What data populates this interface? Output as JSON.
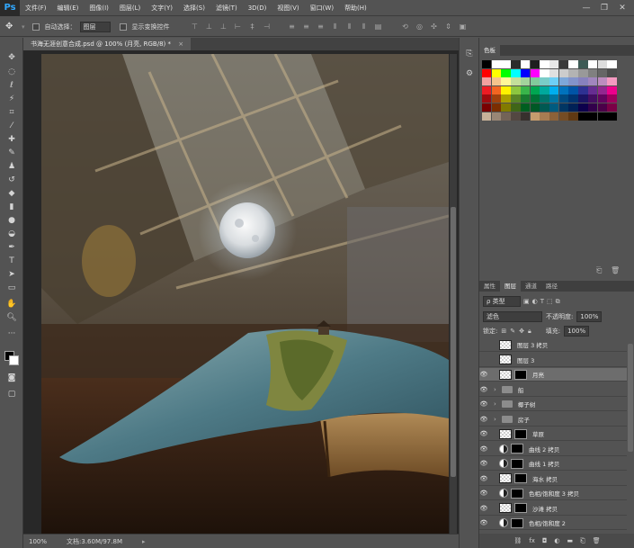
{
  "app": {
    "logo": "Ps"
  },
  "menu": [
    "文件(F)",
    "编辑(E)",
    "图像(I)",
    "图层(L)",
    "文字(Y)",
    "选择(S)",
    "滤镜(T)",
    "3D(D)",
    "视图(V)",
    "窗口(W)",
    "帮助(H)"
  ],
  "window_controls": {
    "minimize": "—",
    "restore": "❐",
    "close": "✕"
  },
  "options": {
    "move_icon": "move-icon",
    "auto_select_label": "自动选择：",
    "auto_select_value": "图层",
    "show_transform_label": "显示变换控件"
  },
  "document": {
    "tab_title": "书海无涯创意合成.psd @ 100% (月亮, RGB/8) *",
    "close": "×"
  },
  "status": {
    "zoom": "100%",
    "doc_size": "文档:3.60M/97.8M"
  },
  "panels": {
    "swatches_tab": "色板",
    "layer_tabs": [
      "属性",
      "图层",
      "通道",
      "路径"
    ],
    "filter_kind": "ρ 类型",
    "blend_mode": "滤色",
    "opacity_label": "不透明度:",
    "opacity_value": "100%",
    "lock_label": "锁定:",
    "fill_label": "填充:",
    "fill_value": "100%"
  },
  "swatch_colors": [
    [
      "#000000",
      "#ffffff",
      "#ffffff",
      "#2b2b2b",
      "#ffffff",
      "#1e1e1e",
      "#ffffff",
      "#e8e8e8",
      "#3a3a3a",
      "#ffffff",
      "#3d5b55",
      "#ffffff",
      "#dddddd",
      "#ffffff"
    ],
    [
      "#ff0000",
      "#ffff00",
      "#00ff00",
      "#00ffff",
      "#0000ff",
      "#ff00ff",
      "#ffffff",
      "#e0e0e0",
      "#cccccc",
      "#b3b3b3",
      "#999999",
      "#808080",
      "#666666",
      "#4d4d4d"
    ],
    [
      "#f2a0a0",
      "#f5c48c",
      "#fff799",
      "#c4df9b",
      "#a3d39c",
      "#82ca9c",
      "#7accc8",
      "#6dcff6",
      "#7da7d9",
      "#8393ca",
      "#8781bd",
      "#a186be",
      "#bd8cbf",
      "#f49ac1"
    ],
    [
      "#ed1c24",
      "#f26522",
      "#fff200",
      "#8dc63f",
      "#39b54a",
      "#00a651",
      "#00a99d",
      "#00aeef",
      "#0072bc",
      "#0054a6",
      "#2e3192",
      "#662d91",
      "#92278f",
      "#ec008c"
    ],
    [
      "#9e0b0f",
      "#a0410d",
      "#aba000",
      "#598527",
      "#197b30",
      "#007236",
      "#00746b",
      "#0076a3",
      "#004a80",
      "#003471",
      "#1b1464",
      "#440e62",
      "#630460",
      "#9e005d"
    ],
    [
      "#790000",
      "#7b2e00",
      "#827b00",
      "#406618",
      "#005e20",
      "#005826",
      "#005952",
      "#005b7f",
      "#003663",
      "#002157",
      "#0d004c",
      "#32004b",
      "#4b0049",
      "#7b0046"
    ],
    [
      "#c7b299",
      "#998675",
      "#736357",
      "#534741",
      "#37302d",
      "#c69c6d",
      "#a67c52",
      "#8c6239",
      "#754c24",
      "#603913",
      "#000000",
      "#000000",
      "#000000",
      "#000000"
    ]
  ],
  "layers": [
    {
      "name": "图层 3 拷贝",
      "visible": false,
      "kind": "pixel"
    },
    {
      "name": "图层 3",
      "visible": false,
      "kind": "pixel"
    },
    {
      "name": "月亮",
      "visible": true,
      "kind": "masked",
      "selected": true
    },
    {
      "name": "船",
      "visible": true,
      "kind": "group"
    },
    {
      "name": "椰子树",
      "visible": true,
      "kind": "group"
    },
    {
      "name": "房子",
      "visible": true,
      "kind": "group"
    },
    {
      "name": "草原",
      "visible": true,
      "kind": "masked"
    },
    {
      "name": "曲线 2 拷贝",
      "visible": true,
      "kind": "adjustment"
    },
    {
      "name": "曲线 1 拷贝",
      "visible": true,
      "kind": "adjustment"
    },
    {
      "name": "海水 拷贝",
      "visible": true,
      "kind": "masked"
    },
    {
      "name": "色相/饱和度 3 拷贝",
      "visible": true,
      "kind": "adjustment"
    },
    {
      "name": "沙滩 拷贝",
      "visible": true,
      "kind": "masked"
    },
    {
      "name": "色相/饱和度 2",
      "visible": true,
      "kind": "adjustment"
    }
  ],
  "layer_bottom_icons": [
    "link-icon",
    "fx-icon",
    "mask-icon",
    "adjustment-icon",
    "folder-icon",
    "new-layer-icon",
    "trash-icon"
  ]
}
